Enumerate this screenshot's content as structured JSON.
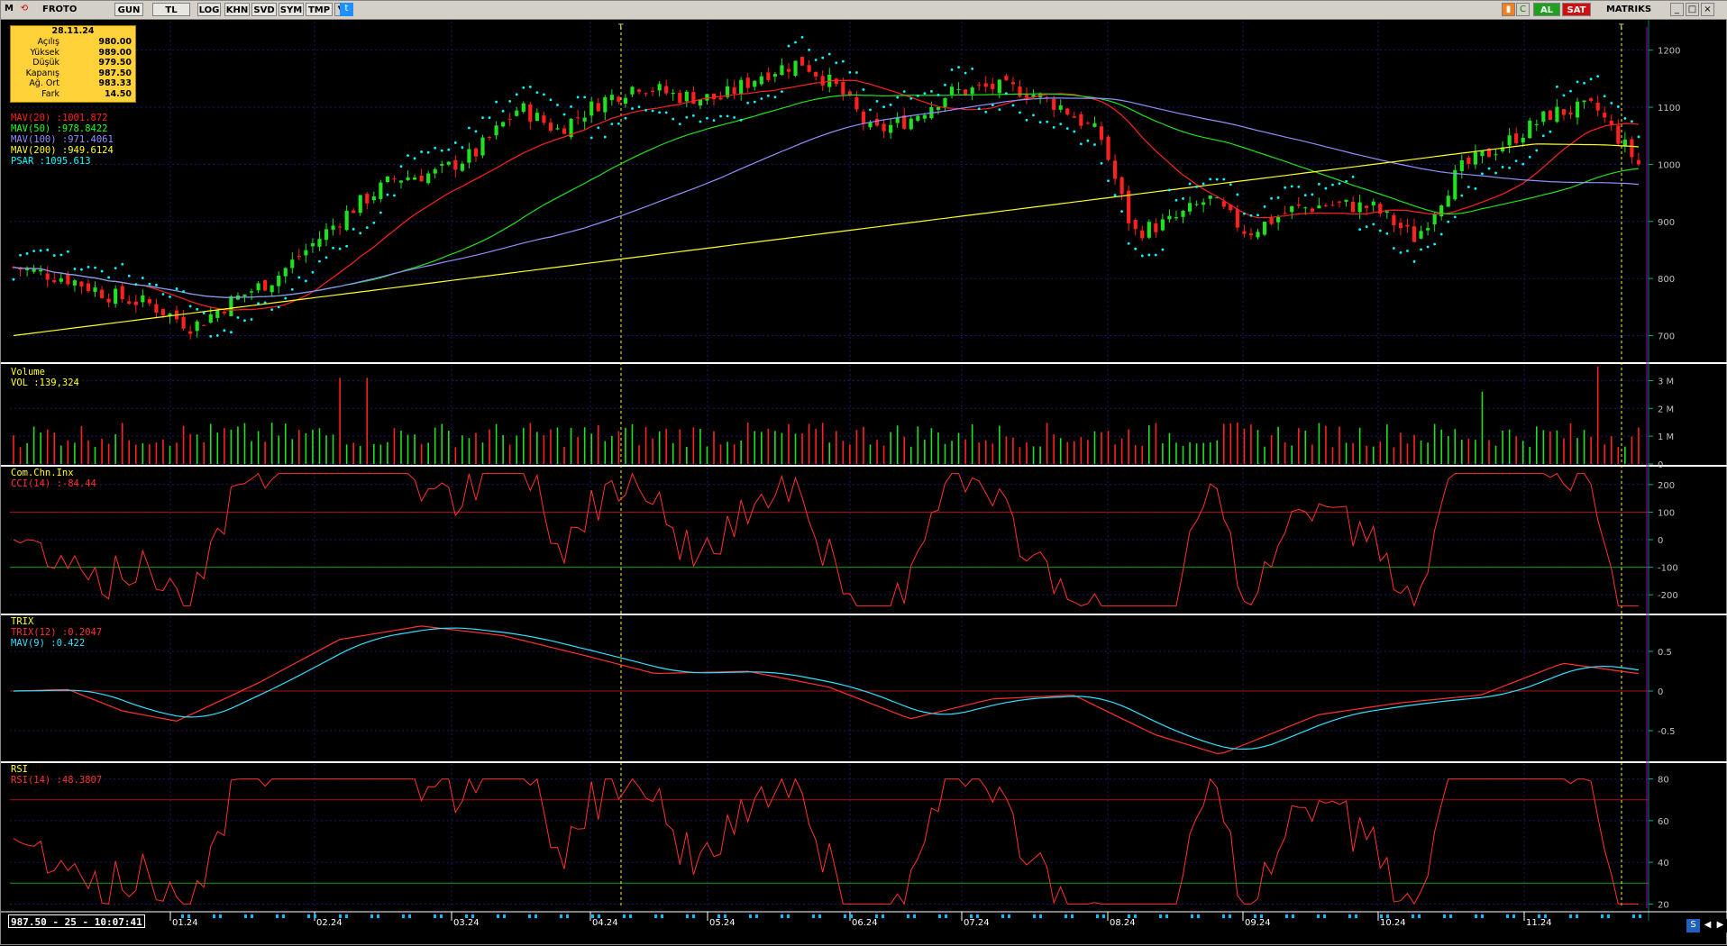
{
  "toolbar": {
    "logo": "M",
    "symbol": "FROTO",
    "buttons": [
      "GUN",
      "TL",
      "LOG",
      "KHN",
      "SVD",
      "SYM",
      "TMP"
    ],
    "right_buttons": {
      "al": "AL",
      "sat": "SAT",
      "brand": "MATRIKS"
    }
  },
  "infobox": {
    "date": "28.11.24",
    "rows": [
      {
        "label": "Açılış",
        "value": "980.00"
      },
      {
        "label": "Yüksek",
        "value": "989.00"
      },
      {
        "label": "Düşük",
        "value": "979.50"
      },
      {
        "label": "Kapanış",
        "value": "987.50"
      },
      {
        "label": "Ağ. Ort",
        "value": "983.33"
      },
      {
        "label": "Fark",
        "value": "14.50"
      }
    ]
  },
  "price_panel": {
    "legend": [
      {
        "name": "MAV(20)",
        "value": ":1001.872",
        "color": "#ff2020"
      },
      {
        "name": "MAV(50)",
        "value": ":978.8422",
        "color": "#20ff20"
      },
      {
        "name": "MAV(100)",
        "value": ":971.4061",
        "color": "#9090ff"
      },
      {
        "name": "MAV(200)",
        "value": ":949.6124",
        "color": "#ffff20"
      },
      {
        "name": "PSAR",
        "value": ":1095.613",
        "color": "#00ffff"
      }
    ],
    "axis": [
      "1200",
      "1100",
      "1000",
      "900",
      "800",
      "700"
    ]
  },
  "volume_panel": {
    "title": "Volume",
    "legend": {
      "name": "VOL",
      "value": ":139,324"
    },
    "axis": [
      "3 M",
      "2 M",
      "1 M",
      "0"
    ]
  },
  "cci_panel": {
    "title": "Com.Chn.Inx",
    "legend": {
      "name": "CCI(14)",
      "value": ":-84.44"
    },
    "axis": [
      "200",
      "100",
      "0",
      "-100",
      "-200"
    ]
  },
  "trix_panel": {
    "title": "TRIX",
    "legend": [
      {
        "name": "TRIX(12)",
        "value": ":0.2047",
        "color": "#ff3030"
      },
      {
        "name": "MAV(9)",
        "value": ":0.422",
        "color": "#30e0ff"
      }
    ],
    "axis": [
      "0.5",
      "0",
      "-0.5"
    ]
  },
  "rsi_panel": {
    "title": "RSI",
    "legend": {
      "name": "RSI(14)",
      "value": ":48.3807"
    },
    "axis": [
      "80",
      "60",
      "40",
      "20"
    ]
  },
  "markers": [
    "T",
    "T"
  ],
  "time_axis": [
    "01.24",
    "02.24",
    "03.24",
    "04.24",
    "05.24",
    "06.24",
    "07.24",
    "08.24",
    "09.24",
    "10.24",
    "11.24"
  ],
  "status": "987.50 - 25 - 10:07:41",
  "colors": {
    "up": "#20e020",
    "down": "#ff2020",
    "grid": "#1a1a6a",
    "axis_text": "#c0c0c0"
  }
}
